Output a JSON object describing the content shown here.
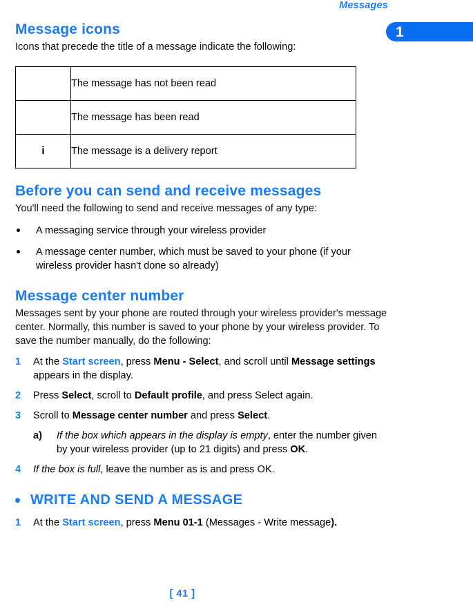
{
  "header": {
    "running_title": "Messages",
    "chapter_number": "1"
  },
  "footer": {
    "page_label": "[ 41 ]"
  },
  "sections": {
    "message_icons": {
      "heading": "Message icons",
      "intro": "Icons that precede the title of a message indicate the following:",
      "table": {
        "rows": [
          {
            "icon": "",
            "icon_name": "unread-message-icon",
            "description": "The message has not been read"
          },
          {
            "icon": "",
            "icon_name": "read-message-icon",
            "description": "The message has been read"
          },
          {
            "icon": "i",
            "icon_name": "delivery-report-icon",
            "description": "The message is a delivery report"
          }
        ]
      }
    },
    "before_send": {
      "heading": "Before you can send and receive messages",
      "intro": "You'll need the following to send and receive messages of any type:",
      "bullets": [
        "A messaging service through your wireless provider",
        "A message center number, which must be saved to your phone (if your wireless provider hasn't done so already)"
      ]
    },
    "message_center": {
      "heading": "Message center number",
      "intro": "Messages sent by your phone are routed through your wireless provider's message center. Normally, this number is saved to your phone by your wireless provider. To save the number manually, do the following:",
      "steps": [
        {
          "num": "1",
          "run_1": "At the ",
          "run_2_blue_bold": "Start screen",
          "run_3": ", press ",
          "run_4_bold": "Menu - Select",
          "run_5": ", and scroll until ",
          "run_6_bold": "Message settings",
          "run_7": " appears in the display."
        },
        {
          "num": "2",
          "run_1": "Press ",
          "run_2_bold": "Select",
          "run_3": ", scroll to ",
          "run_4_bold": "Default profile",
          "run_5": ", and press Select again."
        },
        {
          "num": "3",
          "run_1": "Scroll to ",
          "run_2_bold": "Message center number",
          "run_3": " and press ",
          "run_4_bold": "Select",
          "run_5": "."
        }
      ],
      "substep": {
        "label": "a)",
        "run_1_italic": "If the box which appears in the display is empty",
        "run_2": ", enter the number given by your wireless provider (up to 21 digits) and press ",
        "run_3_bold": "OK",
        "run_4": "."
      },
      "step4": {
        "num": "4",
        "run_1_italic": "If the box is full",
        "run_2": ", leave the number as is and press OK."
      }
    },
    "write_send": {
      "heading": "WRITE AND SEND A MESSAGE",
      "steps": [
        {
          "num": "1",
          "run_1": "At the ",
          "run_2_blue_bold": "Start screen",
          "run_3": ", press ",
          "run_4_bold": "Menu 01-1",
          "run_5": " (Messages - Write message",
          "run_6_bold": ")."
        }
      ]
    }
  },
  "colors": {
    "accent_blue": "#1a7cf5",
    "tab_blue": "#0a6ef2",
    "text_black": "#0d0d0d"
  }
}
